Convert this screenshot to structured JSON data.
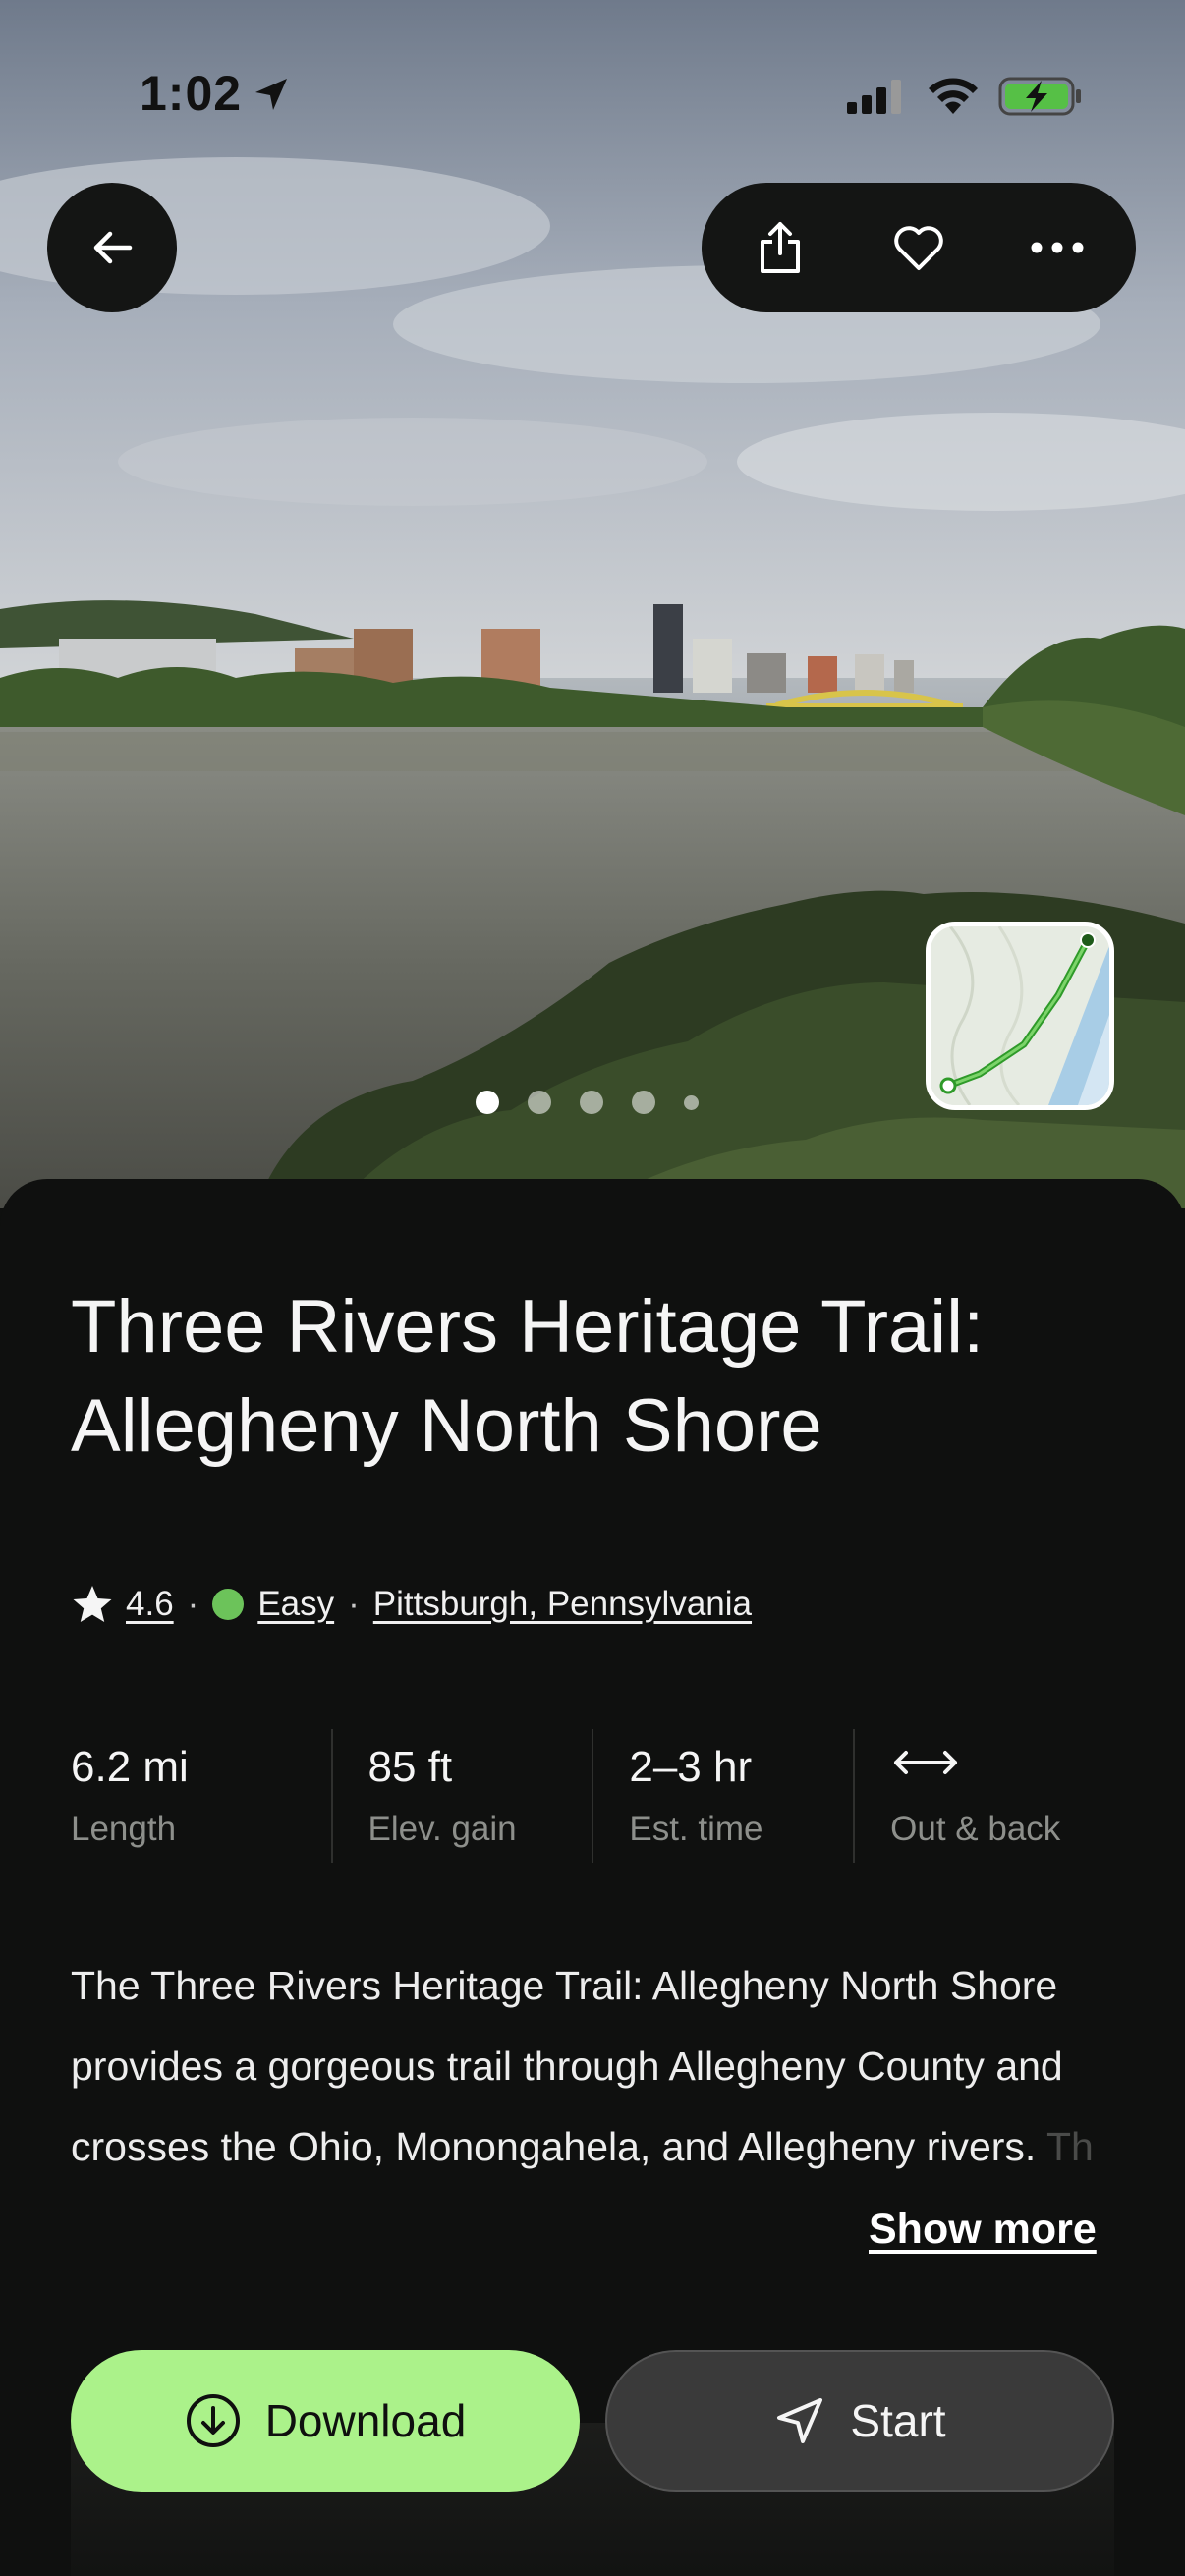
{
  "status_bar": {
    "time": "1:02"
  },
  "icons": {
    "location": "location-arrow-icon",
    "signal": "cellular-signal-icon",
    "wifi": "wifi-icon",
    "battery": "battery-charging-icon",
    "back": "arrow-left-icon",
    "share": "share-icon",
    "favorite": "heart-icon",
    "more": "more-dots-icon",
    "rating": "star-icon",
    "route": "out-and-back-arrow-icon",
    "download": "download-circle-icon",
    "start": "navigation-arrow-icon"
  },
  "gallery": {
    "photo_count": 5,
    "active_index": 0
  },
  "trail": {
    "title": "Three Rivers Heritage Trail: Allegheny North Shore",
    "rating": "4.6",
    "difficulty": "Easy",
    "difficulty_color": "#6cc35a",
    "location": "Pittsburgh, Pennsylvania"
  },
  "stats": [
    {
      "value": "6.2 mi",
      "label": "Length"
    },
    {
      "value": "85 ft",
      "label": "Elev. gain"
    },
    {
      "value": "2–3 hr",
      "label": "Est. time"
    },
    {
      "value": "",
      "label": "Out & back"
    }
  ],
  "description": {
    "text": "The Three Rivers Heritage Trail: Allegheny North Shore provides a gorgeous trail through Allegheny County and crosses the Ohio, Monongahela, and Allegheny rivers.",
    "faded_tail": " Th",
    "show_more_label": "Show more"
  },
  "actions": {
    "download_label": "Download",
    "start_label": "Start"
  },
  "colors": {
    "accent": "#abf28a",
    "background": "#0f100f"
  }
}
